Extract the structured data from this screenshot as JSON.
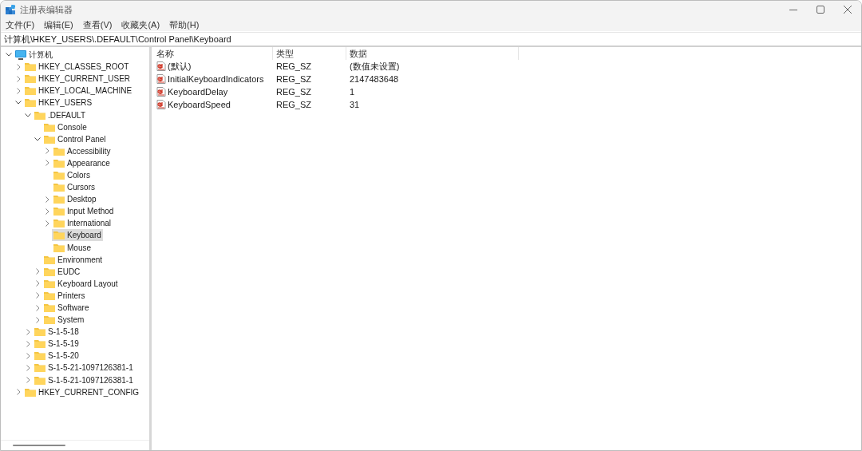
{
  "window": {
    "title": "注册表编辑器"
  },
  "menu": [
    {
      "label": "文件(F)"
    },
    {
      "label": "编辑(E)"
    },
    {
      "label": "查看(V)"
    },
    {
      "label": "收藏夹(A)"
    },
    {
      "label": "帮助(H)"
    }
  ],
  "address": "计算机\\HKEY_USERS\\.DEFAULT\\Control Panel\\Keyboard",
  "tree": [
    {
      "label": "计算机",
      "kind": "computer",
      "expanded": true,
      "selected": false,
      "children": [
        {
          "label": "HKEY_CLASSES_ROOT",
          "kind": "folder",
          "expanded": false,
          "selected": false
        },
        {
          "label": "HKEY_CURRENT_USER",
          "kind": "folder",
          "expanded": false,
          "selected": false
        },
        {
          "label": "HKEY_LOCAL_MACHINE",
          "kind": "folder",
          "expanded": false,
          "selected": false
        },
        {
          "label": "HKEY_USERS",
          "kind": "folder",
          "expanded": true,
          "selected": false,
          "children": [
            {
              "label": ".DEFAULT",
              "kind": "folder",
              "expanded": true,
              "selected": false,
              "children": [
                {
                  "label": "Console",
                  "kind": "leaf",
                  "selected": false
                },
                {
                  "label": "Control Panel",
                  "kind": "folder",
                  "expanded": true,
                  "selected": false,
                  "children": [
                    {
                      "label": "Accessibility",
                      "kind": "folder",
                      "expanded": false,
                      "selected": false
                    },
                    {
                      "label": "Appearance",
                      "kind": "folder",
                      "expanded": false,
                      "selected": false
                    },
                    {
                      "label": "Colors",
                      "kind": "leaf",
                      "selected": false
                    },
                    {
                      "label": "Cursors",
                      "kind": "leaf",
                      "selected": false
                    },
                    {
                      "label": "Desktop",
                      "kind": "folder",
                      "expanded": false,
                      "selected": false
                    },
                    {
                      "label": "Input Method",
                      "kind": "folder",
                      "expanded": false,
                      "selected": false
                    },
                    {
                      "label": "International",
                      "kind": "folder",
                      "expanded": false,
                      "selected": false
                    },
                    {
                      "label": "Keyboard",
                      "kind": "leaf",
                      "selected": true
                    },
                    {
                      "label": "Mouse",
                      "kind": "leaf",
                      "selected": false
                    }
                  ]
                },
                {
                  "label": "Environment",
                  "kind": "leaf",
                  "selected": false
                },
                {
                  "label": "EUDC",
                  "kind": "folder",
                  "expanded": false,
                  "selected": false
                },
                {
                  "label": "Keyboard Layout",
                  "kind": "folder",
                  "expanded": false,
                  "selected": false
                },
                {
                  "label": "Printers",
                  "kind": "folder",
                  "expanded": false,
                  "selected": false
                },
                {
                  "label": "Software",
                  "kind": "folder",
                  "expanded": false,
                  "selected": false
                },
                {
                  "label": "System",
                  "kind": "folder",
                  "expanded": false,
                  "selected": false
                }
              ]
            },
            {
              "label": "S-1-5-18",
              "kind": "folder",
              "expanded": false,
              "selected": false
            },
            {
              "label": "S-1-5-19",
              "kind": "folder",
              "expanded": false,
              "selected": false
            },
            {
              "label": "S-1-5-20",
              "kind": "folder",
              "expanded": false,
              "selected": false
            },
            {
              "label": "S-1-5-21-1097126381-1",
              "kind": "folder",
              "expanded": false,
              "selected": false
            },
            {
              "label": "S-1-5-21-1097126381-1",
              "kind": "folder",
              "expanded": false,
              "selected": false
            }
          ]
        },
        {
          "label": "HKEY_CURRENT_CONFIG",
          "kind": "folder",
          "expanded": false,
          "selected": false
        }
      ]
    }
  ],
  "list": {
    "columns": [
      "名称",
      "类型",
      "数据"
    ],
    "rows": [
      {
        "name": "(默认)",
        "type": "REG_SZ",
        "data": "(数值未设置)"
      },
      {
        "name": "InitialKeyboardIndicators",
        "type": "REG_SZ",
        "data": "2147483648"
      },
      {
        "name": "KeyboardDelay",
        "type": "REG_SZ",
        "data": "1"
      },
      {
        "name": "KeyboardSpeed",
        "type": "REG_SZ",
        "data": "31"
      }
    ]
  }
}
